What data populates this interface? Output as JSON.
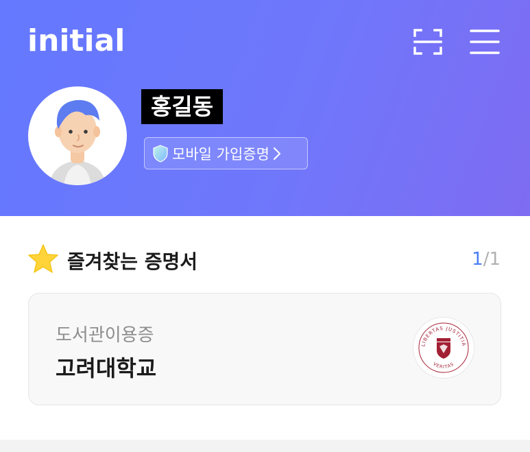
{
  "header": {
    "logo_text": "initial",
    "scan_icon": "qr-scan-icon",
    "menu_icon": "hamburger-menu-icon",
    "gradient_colors": [
      "#6479ff",
      "#7e6cf2"
    ]
  },
  "profile": {
    "name": "홍길동",
    "avatar_icon": "user-avatar-illustration",
    "cert_chip_label": "모바일 가입증명",
    "cert_chip_icon": "shield-icon"
  },
  "favorites": {
    "title": "즐겨찾는 증명서",
    "title_icon": "star-icon",
    "page_current": "1",
    "page_separator": "/",
    "page_total": "1",
    "accent_color": "#4a7df7"
  },
  "card": {
    "type": "도서관이용증",
    "organization": "고려대학교",
    "seal_icon": "korea-university-seal-icon",
    "seal_text_top": "LIBERTAS JUSTITIA",
    "seal_text_bottom": "VERITAS"
  }
}
